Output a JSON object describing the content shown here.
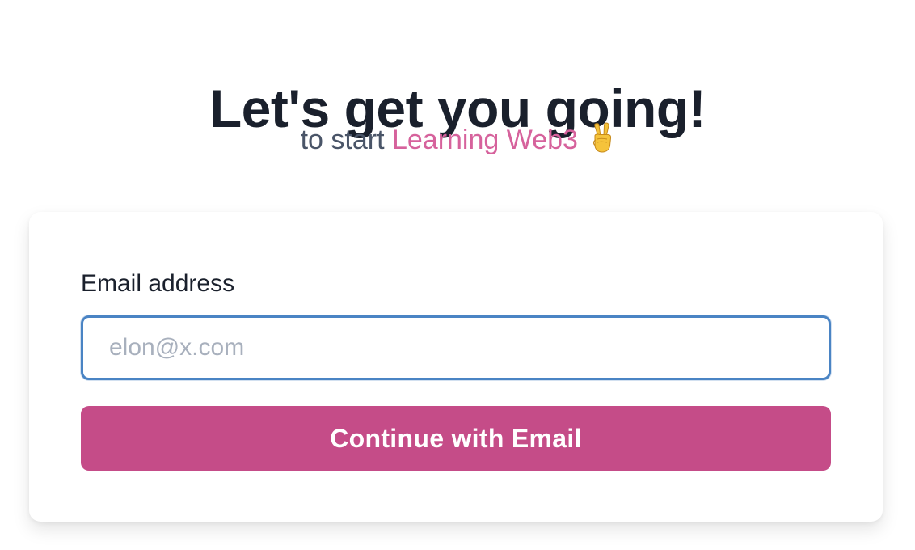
{
  "header": {
    "title": "Let's get you going!",
    "subtitle_prefix": "to start ",
    "subtitle_accent": "Learning Web3",
    "subtitle_emoji": "victory-hand-icon"
  },
  "form": {
    "email_label": "Email address",
    "email_placeholder": "elon@x.com",
    "email_value": "",
    "submit_label": "Continue with Email"
  },
  "colors": {
    "title": "#1a202c",
    "subtitle": "#4a5568",
    "accent": "#d6629c",
    "button": "#c54c88",
    "input_focus_border": "#4a84c4",
    "placeholder": "#a8b0bd"
  }
}
